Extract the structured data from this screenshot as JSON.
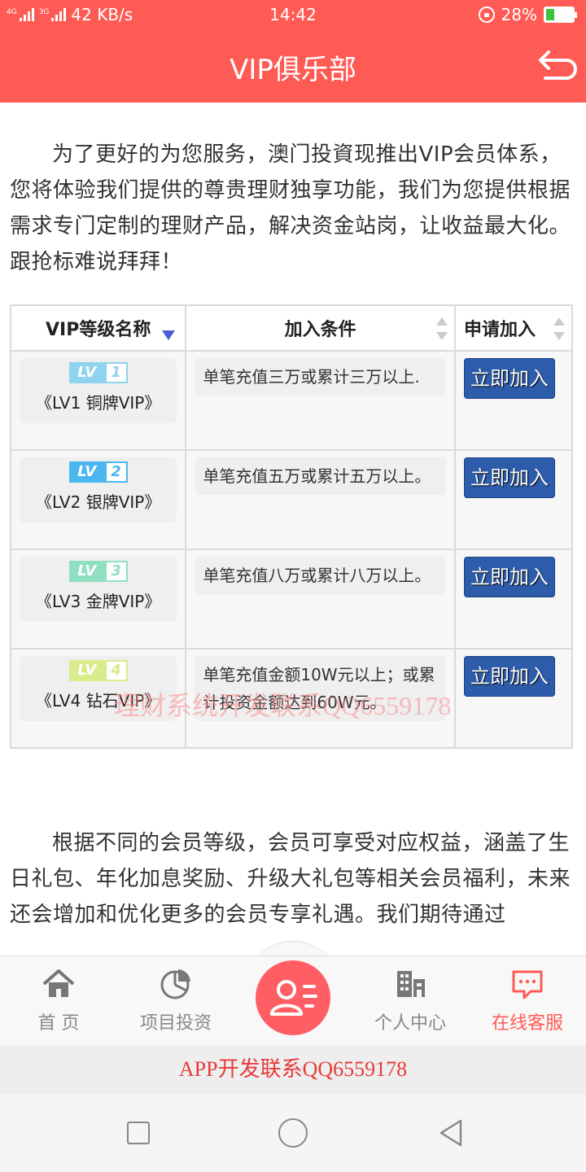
{
  "status_bar": {
    "network": "4G",
    "network2": "3G",
    "speed": "42 KB/s",
    "time": "14:42",
    "battery": "28%",
    "battery_level": 0.28
  },
  "header": {
    "title": "VIP俱乐部",
    "back_icon": "return-arrow-icon"
  },
  "intro_text": "为了更好的为您服务，澳门投資现推出VIP会员体系，您将体验我们提供的尊贵理财独享功能，我们为您提供根据需求专门定制的理财产品，解决资金站岗，让收益最大化。跟抢标难说拜拜！",
  "table": {
    "headers": [
      "VIP等级名称",
      "加入条件",
      "申请加入"
    ],
    "rows": [
      {
        "badge_text": "LV",
        "badge_num": "1",
        "badge_color": "#8fd3ef",
        "name": "《LV1 铜牌VIP》",
        "condition": "单笔充值三万或累计三万以上.",
        "button": "立即加入"
      },
      {
        "badge_text": "LV",
        "badge_num": "2",
        "badge_color": "#4ab8ee",
        "name": "《LV2 银牌VIP》",
        "condition": "单笔充值五万或累计五万以上。",
        "button": "立即加入"
      },
      {
        "badge_text": "LV",
        "badge_num": "3",
        "badge_color": "#8fe0c0",
        "name": "《LV3 金牌VIP》",
        "condition": "单笔充值八万或累计八万以上。",
        "button": "立即加入"
      },
      {
        "badge_text": "LV",
        "badge_num": "4",
        "badge_color": "#d8ec8c",
        "name": "《LV4 钻石VIP》",
        "condition": "单笔充值金额10W元以上；或累计投资金额达到60W元。",
        "button": "立即加入"
      }
    ]
  },
  "watermark": "理财系统开发联系QQ6559178",
  "benefits_text": "根据不同的会员等级，会员可享受对应权益，涵盖了生日礼包、年化加息奖励、升级大礼包等相关会员福利，未来还会增加和优化更多的会员专享礼遇。我们期待通过",
  "tabbar": {
    "items": [
      {
        "label": "首 页",
        "icon": "home-icon"
      },
      {
        "label": "项目投资",
        "icon": "pie-chart-icon"
      },
      {
        "label": "",
        "icon": "user-card-icon"
      },
      {
        "label": "个人中心",
        "icon": "building-icon"
      },
      {
        "label": "在线客服",
        "icon": "chat-bubble-icon"
      }
    ]
  },
  "footer_text": "APP开发联系QQ6559178",
  "colors": {
    "brand": "#ff5b55",
    "button": "#2c5caa",
    "active_tab": "#ff5b55"
  }
}
